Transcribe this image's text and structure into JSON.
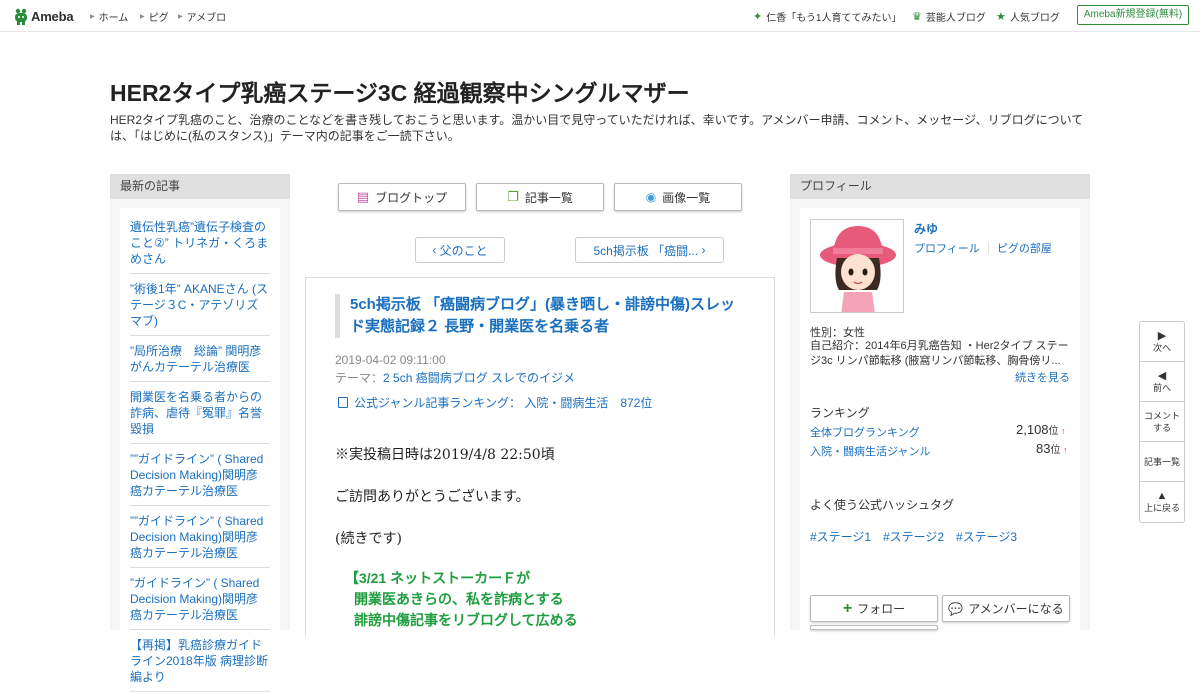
{
  "topbar": {
    "logo": "Ameba",
    "nav": [
      "ホーム",
      "ピグ",
      "アメブロ"
    ],
    "right": [
      "仁香「もう1人育ててみたい」",
      "芸能人ブログ",
      "人気ブログ"
    ],
    "register": "Ameba新規登録(無料)"
  },
  "blog": {
    "title": "HER2タイプ乳癌ステージ3C 経過観察中シングルマザー",
    "description": "HER2タイプ乳癌のこと、治療のことなどを書き残しておこうと思います。温かい目で見守っていただければ、幸いです。アメンバー申請、コメント、メッセージ、リブログについては、「はじめに(私のスタンス)」テーマ内の記事をご一読下さい。"
  },
  "recent": {
    "heading": "最新の記事",
    "items": [
      "遺伝性乳癌”遺伝子検査のこと②” トリネガ・くろまめさん",
      "”術後1年” AKANEさん (ステージ３C・アテゾリズマブ)",
      "”局所治療　総論” 関明彦がんカテーテル治療医",
      "開業医を名乗る者からの詐病、虐待『冤罪』名誉毀損",
      "””ガイドライン” ( Shared Decision Making)関明彦癌カテーテル治療医",
      "””ガイドライン” ( Shared Decision Making)関明彦癌カテーテル治療医",
      "”ガイドライン” ( Shared Decision Making)関明彦癌カテーテル治療医",
      "【再掲】乳癌診療ガイドライン2018年版 病理診断編より"
    ]
  },
  "center": {
    "tabs": [
      "ブログトップ",
      "記事一覧",
      "画像一覧"
    ],
    "prev": "父のこと",
    "next": "5ch掲示板 「癌闘..."
  },
  "article": {
    "title": "5ch掲示板 「癌闘病ブログ」(暴き晒し・誹謗中傷)スレッド実態記録２ 長野・開業医を名乗る者",
    "date": "2019-04-02 09:11:00",
    "theme_label": "テーマ：",
    "theme": "2 5ch 癌闘病ブログ スレでのイジメ",
    "ranking": "公式ジャンル記事ランキング：  入院・闘病生活　872位",
    "p1": "※実投稿日時は2019/4/8  22:50頃",
    "p2": "ご訪問ありがとうございます。",
    "p3": "(続きです)",
    "green": [
      "【3/21  ネットストーカーＦが",
      "開業医あきらの、私を詐病とする",
      "誹謗中傷記事をリブログして広める"
    ]
  },
  "profile": {
    "heading": "プロフィール",
    "name": "みゆ",
    "links": [
      "プロフィール",
      "ピグの部屋"
    ],
    "gender": "性別：女性",
    "intro": "自己紹介：2014年6月乳癌告知 ・Her2タイプ ステージ3c リンパ節転移 (腋窩リンパ節転移、胸骨傍リ...",
    "more": "続きを見る",
    "ranking_heading": "ランキング",
    "rankings": [
      {
        "label": "全体ブログランキング",
        "value": "2,108",
        "unit": "位"
      },
      {
        "label": "入院・闘病生活ジャンル",
        "value": "83",
        "unit": "位"
      }
    ],
    "hashtag_heading": "よく使う公式ハッシュタグ",
    "hashtags": [
      "#ステージ1",
      "#ステージ2",
      "#ステージ3"
    ],
    "follow": "フォロー",
    "amember": "アメンバーになる"
  },
  "sidenav": [
    "次へ",
    "前へ",
    "コメントする",
    "記事一覧",
    "上に戻る"
  ],
  "colors": {
    "link": "#1a6fbf",
    "brand_green": "#2d8c3c",
    "highlight_green": "#1e9e3e"
  }
}
